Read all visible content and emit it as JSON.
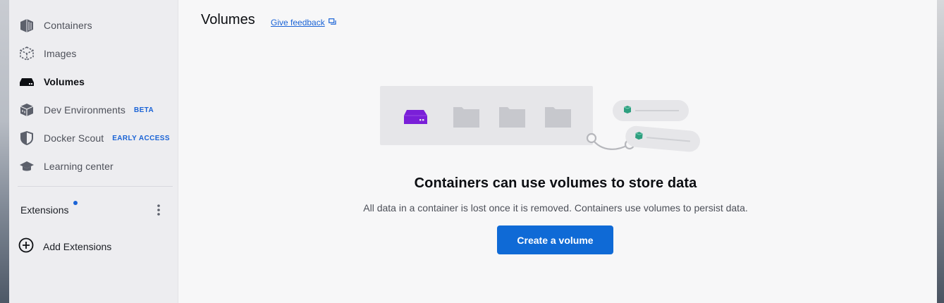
{
  "sidebar": {
    "items": [
      {
        "label": "Containers",
        "icon": "containers-icon"
      },
      {
        "label": "Images",
        "icon": "images-icon"
      },
      {
        "label": "Volumes",
        "icon": "volumes-icon",
        "active": true
      },
      {
        "label": "Dev Environments",
        "icon": "dev-environments-icon",
        "badge": "BETA"
      },
      {
        "label": "Docker Scout",
        "icon": "docker-scout-icon",
        "badge": "EARLY ACCESS"
      },
      {
        "label": "Learning center",
        "icon": "learning-center-icon"
      }
    ],
    "extensions_label": "Extensions",
    "add_extensions_label": "Add Extensions"
  },
  "header": {
    "title": "Volumes",
    "feedback_link": "Give feedback"
  },
  "empty_state": {
    "headline": "Containers can use volumes to store data",
    "description": "All data in a container is lost once it is removed. Containers use volumes to persist data.",
    "button_label": "Create a volume"
  },
  "colors": {
    "accent": "#0f6ad6",
    "badge": "#1a63d6",
    "volume_purple": "#7a1fd8",
    "container_green": "#2e9f7f"
  }
}
